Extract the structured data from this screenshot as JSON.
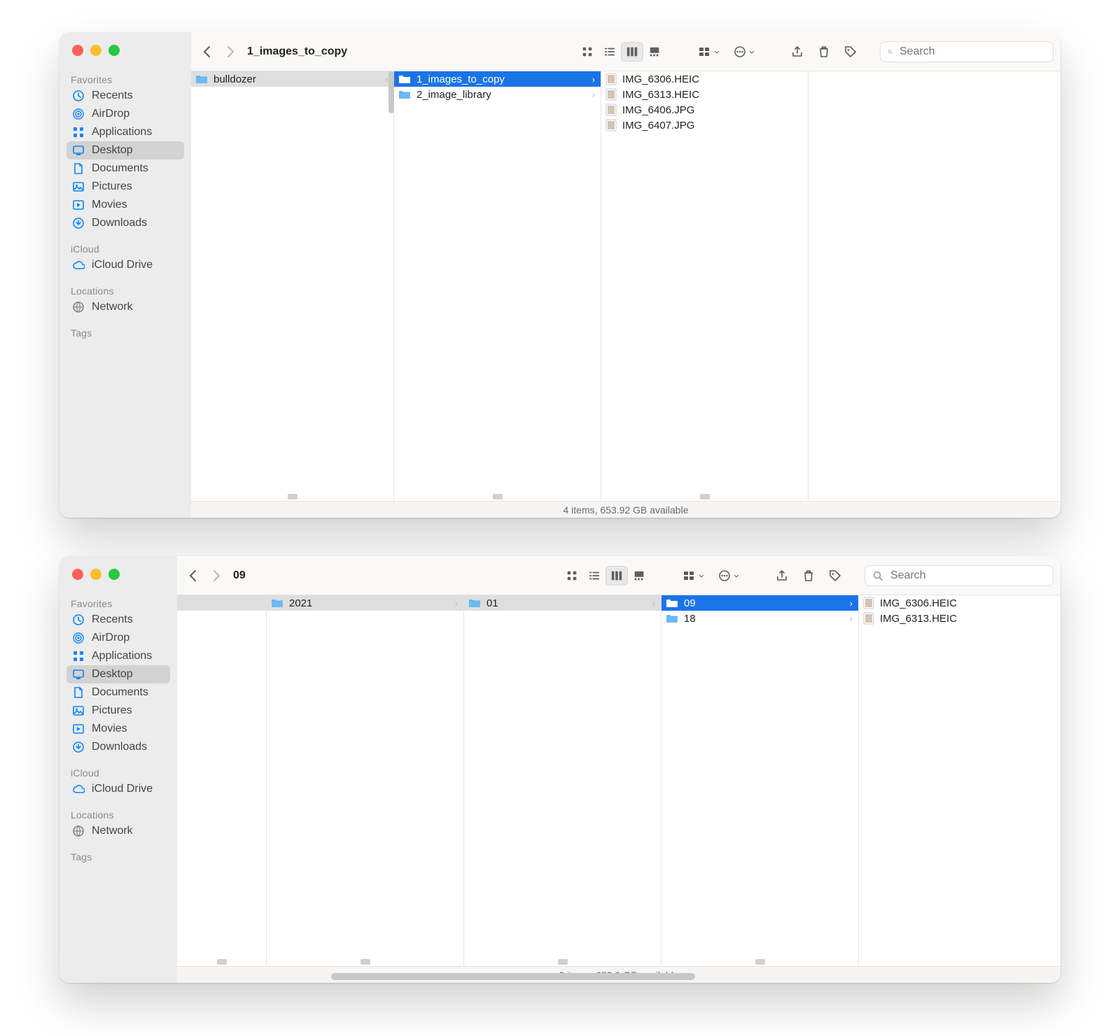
{
  "sidebar": {
    "sections": {
      "favorites": {
        "label": "Favorites",
        "items": [
          {
            "icon": "clock",
            "label": "Recents"
          },
          {
            "icon": "airdrop",
            "label": "AirDrop"
          },
          {
            "icon": "apps",
            "label": "Applications"
          },
          {
            "icon": "desktop",
            "label": "Desktop",
            "selected": true
          },
          {
            "icon": "doc",
            "label": "Documents"
          },
          {
            "icon": "pictures",
            "label": "Pictures"
          },
          {
            "icon": "movies",
            "label": "Movies"
          },
          {
            "icon": "download",
            "label": "Downloads"
          }
        ]
      },
      "icloud": {
        "label": "iCloud",
        "items": [
          {
            "icon": "cloud",
            "label": "iCloud Drive"
          }
        ]
      },
      "locations": {
        "label": "Locations",
        "items": [
          {
            "icon": "network",
            "label": "Network"
          }
        ]
      },
      "tags": {
        "label": "Tags",
        "items": []
      }
    }
  },
  "w1": {
    "title": "1_images_to_copy",
    "status": "4 items, 653.92 GB available",
    "search_placeholder": "Search",
    "cols": [
      [
        {
          "type": "folder",
          "name": "bulldozer",
          "sel": "grey"
        }
      ],
      [
        {
          "type": "folder",
          "name": "1_images_to_copy",
          "sel": "blue"
        },
        {
          "type": "folder",
          "name": "2_image_library"
        }
      ],
      [
        {
          "type": "thumb",
          "name": "IMG_6306.HEIC"
        },
        {
          "type": "thumb",
          "name": "IMG_6313.HEIC"
        },
        {
          "type": "thumb",
          "name": "IMG_6406.JPG"
        },
        {
          "type": "thumb",
          "name": "IMG_6407.JPG"
        }
      ]
    ]
  },
  "w2": {
    "title": "09",
    "status": "2 items, 653.9 GB available",
    "search_placeholder": "Search",
    "cols": [
      [],
      [
        {
          "type": "folder",
          "name": "2021",
          "sel": "grey"
        }
      ],
      [
        {
          "type": "folder",
          "name": "01",
          "sel": "grey"
        }
      ],
      [
        {
          "type": "folder",
          "name": "09",
          "sel": "blue"
        },
        {
          "type": "folder",
          "name": "18"
        }
      ],
      [
        {
          "type": "thumb",
          "name": "IMG_6306.HEIC"
        },
        {
          "type": "thumb",
          "name": "IMG_6313.HEIC"
        }
      ]
    ]
  }
}
